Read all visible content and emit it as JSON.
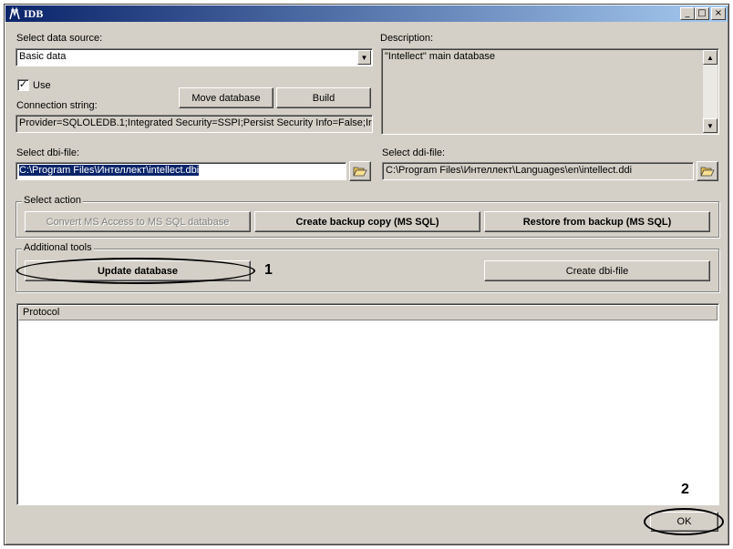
{
  "window": {
    "title": "IDB",
    "minimize": "_",
    "maximize": "□",
    "close": "×"
  },
  "data_source": {
    "label": "Select data source:",
    "value": "Basic data"
  },
  "description": {
    "label": "Description:",
    "value": "\"Intellect\" main database"
  },
  "use_checkbox": {
    "label": "Use",
    "checked": true
  },
  "buttons": {
    "move_database": "Move database",
    "build": "Build"
  },
  "connection": {
    "label": "Connection string:",
    "value": "Provider=SQLOLEDB.1;Integrated Security=SSPI;Persist Security Info=False;Ir"
  },
  "dbi": {
    "label": "Select dbi-file:",
    "value": "C:\\Program Files\\Интеллект\\intellect.dbi"
  },
  "ddi": {
    "label": "Select ddi-file:",
    "value": "C:\\Program Files\\Интеллект\\Languages\\en\\intellect.ddi"
  },
  "select_action": {
    "title": "Select action",
    "convert": "Convert MS Access to MS SQL database",
    "backup": "Create backup copy (MS SQL)",
    "restore": "Restore from backup (MS SQL)"
  },
  "additional_tools": {
    "title": "Additional tools",
    "update": "Update database",
    "create_dbi": "Create dbi-file"
  },
  "protocol": {
    "header": "Protocol"
  },
  "ok_label": "OK",
  "annotations": {
    "one": "1",
    "two": "2"
  }
}
